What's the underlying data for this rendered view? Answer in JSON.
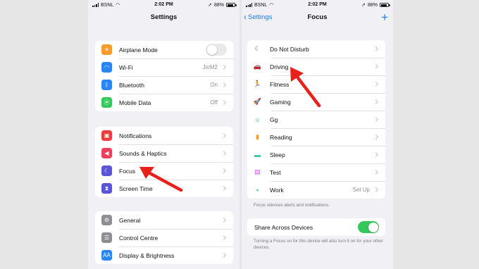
{
  "left_phone": {
    "status": {
      "carrier": "BSNL",
      "time": "2:02 PM",
      "battery": "88%"
    },
    "title": "Settings",
    "groups": [
      [
        {
          "label": "Airplane Mode",
          "icon": "airplane-icon",
          "color": "#f59c2a",
          "glyph": "✈",
          "toggle": "off"
        },
        {
          "label": "Wi-Fi",
          "icon": "wifi-icon",
          "color": "#2a85f5",
          "glyph": "◠",
          "value": "JioM2"
        },
        {
          "label": "Bluetooth",
          "icon": "bluetooth-icon",
          "color": "#2a85f5",
          "glyph": "ᛒ",
          "value": "On"
        },
        {
          "label": "Mobile Data",
          "icon": "antenna-icon",
          "color": "#34c759",
          "glyph": "⦿",
          "value": "Off"
        }
      ],
      [
        {
          "label": "Notifications",
          "icon": "bell-icon",
          "color": "#ef3b3b",
          "glyph": "▣"
        },
        {
          "label": "Sounds & Haptics",
          "icon": "speaker-icon",
          "color": "#ee3f5c",
          "glyph": "◀"
        },
        {
          "label": "Focus",
          "icon": "moon-icon",
          "color": "#5b55d6",
          "glyph": "☾"
        },
        {
          "label": "Screen Time",
          "icon": "hourglass-icon",
          "color": "#5b55d6",
          "glyph": "⧗"
        }
      ],
      [
        {
          "label": "General",
          "icon": "gear-icon",
          "color": "#8e8e93",
          "glyph": "⚙"
        },
        {
          "label": "Control Centre",
          "icon": "switches-icon",
          "color": "#8e8e93",
          "glyph": "☰"
        },
        {
          "label": "Display & Brightness",
          "icon": "aa-icon",
          "color": "#2a85f5",
          "glyph": "AA"
        }
      ]
    ]
  },
  "right_phone": {
    "status": {
      "carrier": "BSNL",
      "time": "2:02 PM",
      "battery": "88%"
    },
    "back_label": "Settings",
    "title": "Focus",
    "focus_items": [
      {
        "label": "Do Not Disturb",
        "icon": "moon-icon",
        "color": "#5b55d6",
        "glyph": "☾"
      },
      {
        "label": "Driving",
        "icon": "car-icon",
        "color": "#5b55d6",
        "glyph": "🚗"
      },
      {
        "label": "Fitness",
        "icon": "running-icon",
        "color": "#34c759",
        "glyph": "🏃"
      },
      {
        "label": "Gaming",
        "icon": "rocket-icon",
        "color": "#2a85f5",
        "glyph": "🚀"
      },
      {
        "label": "Gg",
        "icon": "smiley-icon",
        "color": "#34c759",
        "glyph": "☺"
      },
      {
        "label": "Reading",
        "icon": "book-icon",
        "color": "#f59c2a",
        "glyph": "▮"
      },
      {
        "label": "Sleep",
        "icon": "bed-icon",
        "color": "#2ec4a8",
        "glyph": "▬"
      },
      {
        "label": "Test",
        "icon": "list-icon",
        "color": "#c459d9",
        "glyph": "▤"
      },
      {
        "label": "Work",
        "icon": "badge-icon",
        "color": "#2ec4a8",
        "glyph": "▪",
        "value": "Set Up"
      }
    ],
    "focus_note": "Focus silences alerts and notifications.",
    "share_label": "Share Across Devices",
    "share_toggle": "on",
    "share_note": "Turning a Focus on for this device will also turn it on for your other devices."
  },
  "annotation_color": "#e8201a"
}
